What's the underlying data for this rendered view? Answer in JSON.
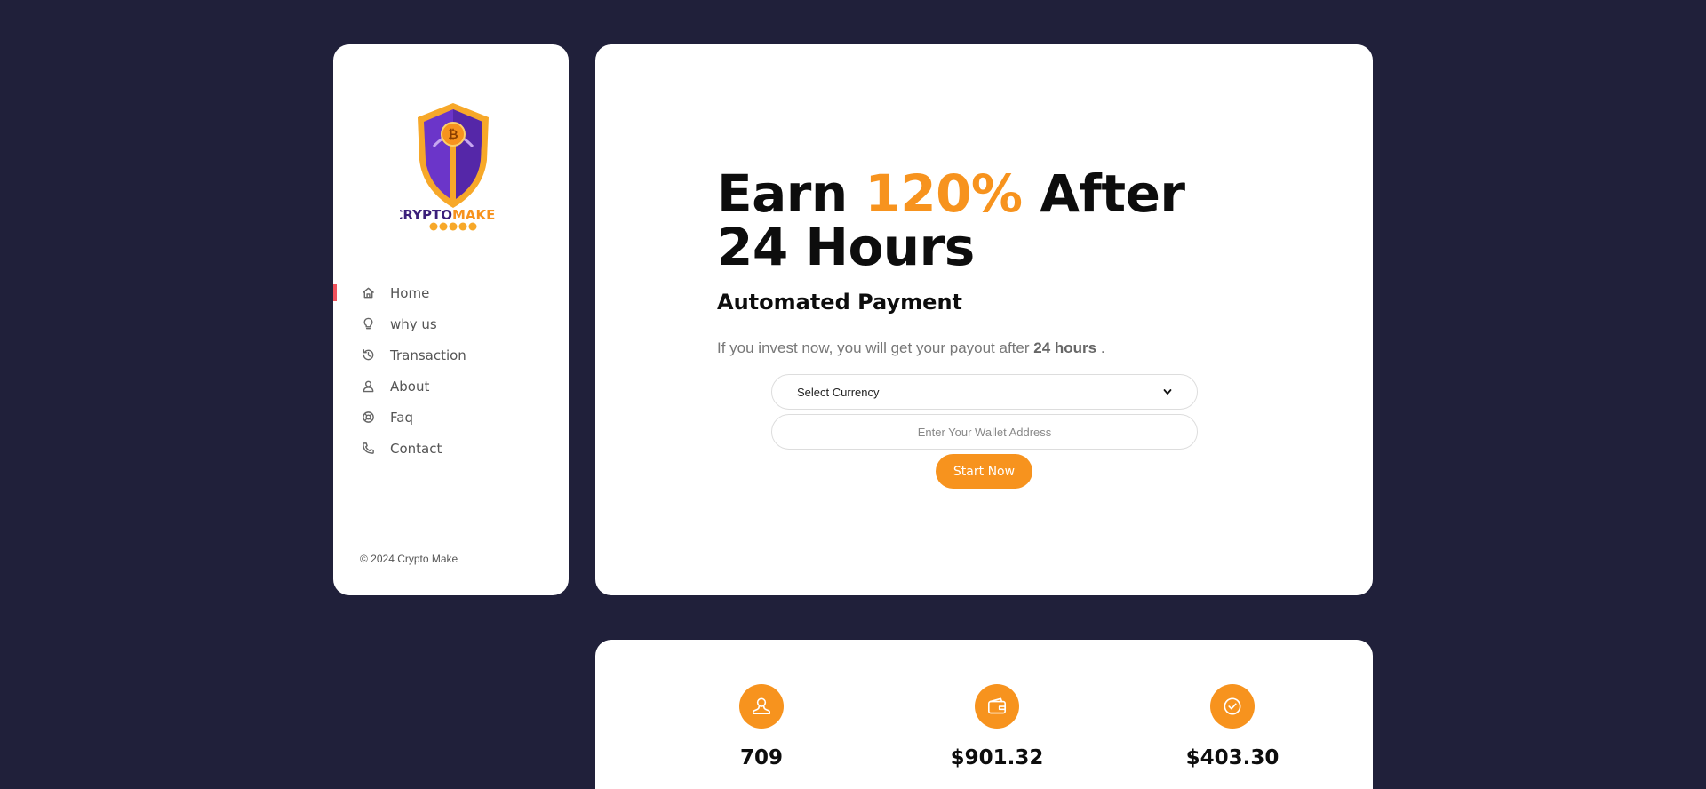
{
  "brand": {
    "name_part1": "CRYPTO",
    "name_part2": "MAKE",
    "copyright": "© 2024 Crypto Make"
  },
  "nav": [
    {
      "label": "Home",
      "icon": "home-icon",
      "active": true
    },
    {
      "label": "why us",
      "icon": "lightbulb-icon",
      "active": false
    },
    {
      "label": "Transaction",
      "icon": "history-icon",
      "active": false
    },
    {
      "label": "About",
      "icon": "user-icon",
      "active": false
    },
    {
      "label": "Faq",
      "icon": "lifebuoy-icon",
      "active": false
    },
    {
      "label": "Contact",
      "icon": "phone-icon",
      "active": false
    }
  ],
  "hero": {
    "headline_prefix": "Earn ",
    "headline_accent": "120%",
    "headline_suffix": " After 24 Hours",
    "subheadline": "Automated Payment",
    "desc_prefix": "If you invest now, you will get your payout after ",
    "desc_bold": "24 hours",
    "desc_suffix": " .",
    "currency_select": "Select Currency",
    "wallet_placeholder": "Enter Your Wallet Address",
    "start_button": "Start Now"
  },
  "stats": [
    {
      "icon": "user-icon",
      "value": "709"
    },
    {
      "icon": "wallet-icon",
      "value": "$901.32"
    },
    {
      "icon": "check-circle-icon",
      "value": "$403.30"
    }
  ],
  "colors": {
    "accent": "#f7931e",
    "background": "#20203a",
    "active_marker": "#f0525d",
    "logo_purple": "#6b35c9"
  }
}
